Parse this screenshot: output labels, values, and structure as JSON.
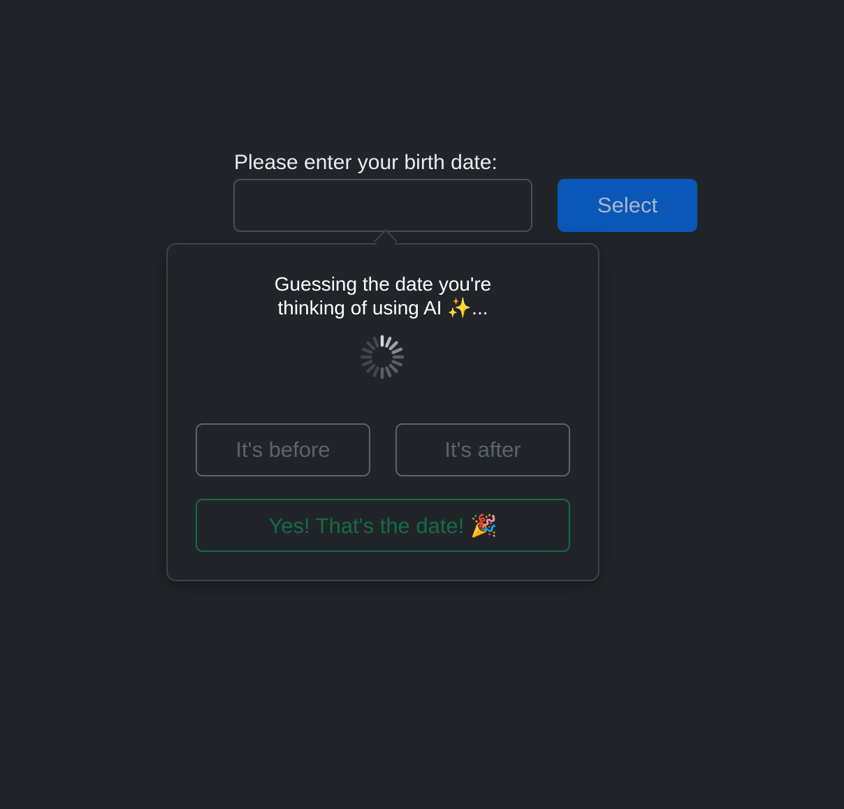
{
  "form": {
    "label": "Please enter your birth date:",
    "input_value": "",
    "input_placeholder": "",
    "select_label": "Select"
  },
  "popover": {
    "message_line1": "Guessing the date you're",
    "message_line2": "thinking of using AI ✨...",
    "before_label": "It's before",
    "after_label": "It's after",
    "confirm_label": "Yes! That's the date! 🎉"
  },
  "colors": {
    "background": "#212529",
    "primary_button": "#0b57b8",
    "success_outline": "#146c43",
    "secondary_outline": "#5c636a"
  },
  "icons": {
    "loading": "spinner-icon"
  }
}
